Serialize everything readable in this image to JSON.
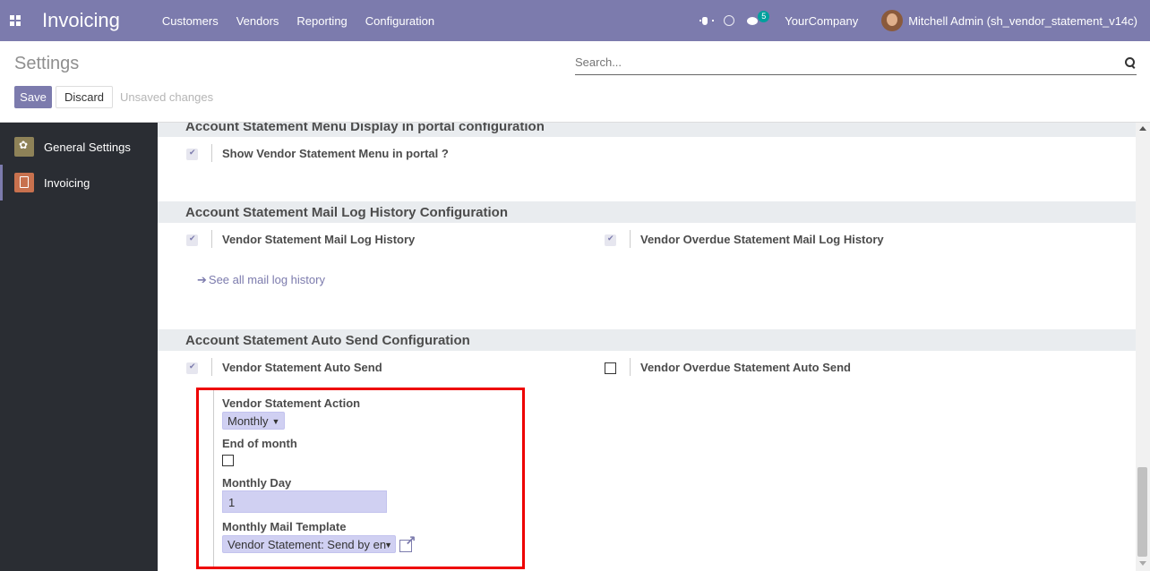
{
  "navbar": {
    "app_name": "Invoicing",
    "menu": [
      "Customers",
      "Vendors",
      "Reporting",
      "Configuration"
    ],
    "chat_count": "5",
    "company": "YourCompany",
    "user": "Mitchell Admin (sh_vendor_statement_v14c)",
    "color": "#7c7bad"
  },
  "control": {
    "title": "Settings",
    "search_placeholder": "Search...",
    "save_label": "Save",
    "discard_label": "Discard",
    "unsaved_label": "Unsaved changes"
  },
  "sidebar": {
    "items": [
      {
        "label": "General Settings",
        "icon": "gear-icon"
      },
      {
        "label": "Invoicing",
        "icon": "invoice-icon",
        "active": true
      }
    ]
  },
  "sections": {
    "portal": {
      "title": "Account Statement Menu Display in portal configuration",
      "setting": {
        "label": "Show Vendor Statement Menu in portal ?",
        "checked": true
      }
    },
    "mail_log": {
      "title": "Account Statement Mail Log History Configuration",
      "left": {
        "label": "Vendor Statement Mail Log History",
        "checked": true
      },
      "right": {
        "label": "Vendor Overdue Statement Mail Log History",
        "checked": true
      },
      "link": "See all mail log history"
    },
    "auto_send": {
      "title": "Account Statement Auto Send Configuration",
      "left": {
        "label": "Vendor Statement Auto Send",
        "checked": true
      },
      "right": {
        "label": "Vendor Overdue Statement Auto Send",
        "checked": false
      },
      "action_label": "Vendor Statement Action",
      "action_value": "Monthly",
      "end_of_month_label": "End of month",
      "end_of_month_checked": false,
      "monthly_day_label": "Monthly Day",
      "monthly_day_value": "1",
      "template_label": "Monthly Mail Template",
      "template_value": "Vendor Statement: Send by en"
    }
  }
}
